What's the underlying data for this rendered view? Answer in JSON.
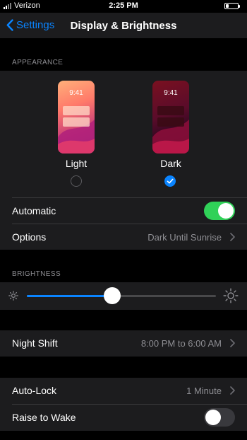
{
  "status_bar": {
    "carrier": "Verizon",
    "time": "2:25 PM"
  },
  "nav": {
    "back_label": "Settings",
    "title": "Display & Brightness"
  },
  "appearance": {
    "header": "APPEARANCE",
    "light": {
      "label": "Light",
      "time": "9:41",
      "selected": false
    },
    "dark": {
      "label": "Dark",
      "time": "9:41",
      "selected": true
    },
    "automatic": {
      "label": "Automatic",
      "on": true
    },
    "options": {
      "label": "Options",
      "value": "Dark Until Sunrise"
    }
  },
  "brightness": {
    "header": "BRIGHTNESS",
    "level": 0.45
  },
  "night_shift": {
    "label": "Night Shift",
    "value": "8:00 PM to 6:00 AM"
  },
  "auto_lock": {
    "label": "Auto-Lock",
    "value": "1 Minute"
  },
  "raise_to_wake": {
    "label": "Raise to Wake",
    "on": false
  },
  "colors": {
    "accent": "#0a84ff",
    "toggle_on": "#30d158",
    "toggle_off": "#39393d"
  }
}
